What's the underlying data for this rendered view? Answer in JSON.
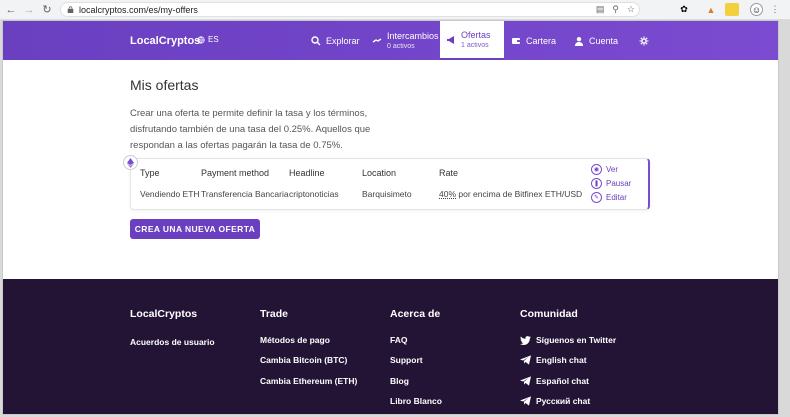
{
  "browser": {
    "url": "localcryptos.com/es/my-offers"
  },
  "header": {
    "brand": "LocalCryptos",
    "lang": "ES",
    "nav": {
      "explorar": "Explorar",
      "intercambios": "Intercambios",
      "intercambios_sub": "0 activos",
      "ofertas": "Ofertas",
      "ofertas_sub": "1 activos",
      "cartera": "Cartera",
      "cuenta": "Cuenta"
    }
  },
  "main": {
    "title": "Mis ofertas",
    "description": "Crear una oferta te permite definir la tasa y los términos, disfrutando también de una tasa del 0.25%. Aquellos que respondan a las ofertas pagarán la tasa de 0.75%.",
    "table": {
      "headers": [
        "Type",
        "Payment method",
        "Headline",
        "Location",
        "Rate"
      ],
      "row": {
        "type": "Vendiendo ETH",
        "payment": "Transferencia Bancaria",
        "headline": "criptonoticias",
        "location": "Barquisimeto",
        "rate_pct": "40%",
        "rate_rest": " por encima de Bitfinex ETH/USD"
      },
      "actions": [
        "Ver",
        "Pausar",
        "Editar"
      ]
    },
    "create_label": "CREA UNA NUEVA OFERTA"
  },
  "footer": {
    "brand": "LocalCryptos",
    "brand_link": "Acuerdos de usuario",
    "trade": {
      "title": "Trade",
      "links": [
        "Métodos de pago",
        "Cambia Bitcoin (BTC)",
        "Cambia Ethereum (ETH)"
      ]
    },
    "about": {
      "title": "Acerca de",
      "links": [
        "FAQ",
        "Support",
        "Blog",
        "Libro Blanco"
      ]
    },
    "community": {
      "title": "Comunidad",
      "links": [
        "Síguenos en Twitter",
        "English chat",
        "Español chat",
        "Русский chat"
      ]
    }
  },
  "colors": {
    "brand_purple": "#6a3fc0",
    "footer_bg": "#231436"
  }
}
